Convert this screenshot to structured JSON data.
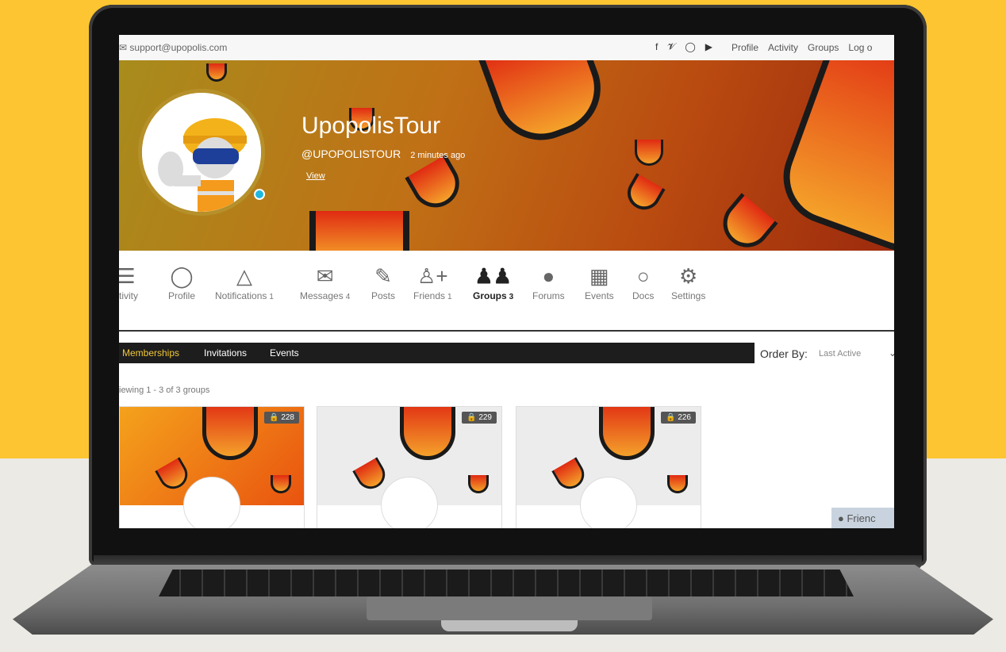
{
  "topbar": {
    "support_email": "support@upopolis.com",
    "social_icons": [
      "facebook-icon",
      "twitter-icon",
      "instagram-icon",
      "youtube-icon"
    ],
    "links": [
      "Profile",
      "Activity",
      "Groups",
      "Log o"
    ]
  },
  "profile": {
    "username": "UpopolisTour",
    "handle": "@UPOPOLISTOUR",
    "last_active": "2 minutes ago",
    "view_link": "View"
  },
  "nav": [
    {
      "label": "ctivity",
      "icon": "list-icon",
      "count": ""
    },
    {
      "label": "Profile",
      "icon": "user-icon",
      "count": ""
    },
    {
      "label": "Notifications",
      "icon": "bell-icon",
      "count": "1"
    },
    {
      "label": "Messages",
      "icon": "envelope-icon",
      "count": "4"
    },
    {
      "label": "Posts",
      "icon": "edit-icon",
      "count": ""
    },
    {
      "label": "Friends",
      "icon": "add-user-icon",
      "count": "1"
    },
    {
      "label": "Groups",
      "icon": "users-icon",
      "count": "3",
      "active": true
    },
    {
      "label": "Forums",
      "icon": "comment-icon",
      "count": ""
    },
    {
      "label": "Events",
      "icon": "calendar-icon",
      "count": ""
    },
    {
      "label": "Docs",
      "icon": "circle-icon",
      "count": ""
    },
    {
      "label": "Settings",
      "icon": "gear-icon",
      "count": ""
    }
  ],
  "subnav": {
    "tabs": [
      "Memberships",
      "Invitations",
      "Events"
    ],
    "active_tab": "Memberships",
    "order_by_label": "Order By:",
    "order_by_value": "Last Active"
  },
  "groups": {
    "viewing_text": "iewing 1 - 3 of 3 groups",
    "cards": [
      {
        "member_count": "228",
        "cover": "orange"
      },
      {
        "member_count": "229",
        "cover": "grey"
      },
      {
        "member_count": "226",
        "cover": "grey"
      }
    ]
  },
  "friends_widget": "Frienc",
  "colors": {
    "background_yellow": "#fdc531",
    "active_subtab": "#f2c838",
    "cover_start": "#a88c1c",
    "cover_end": "#9c2a0d"
  }
}
